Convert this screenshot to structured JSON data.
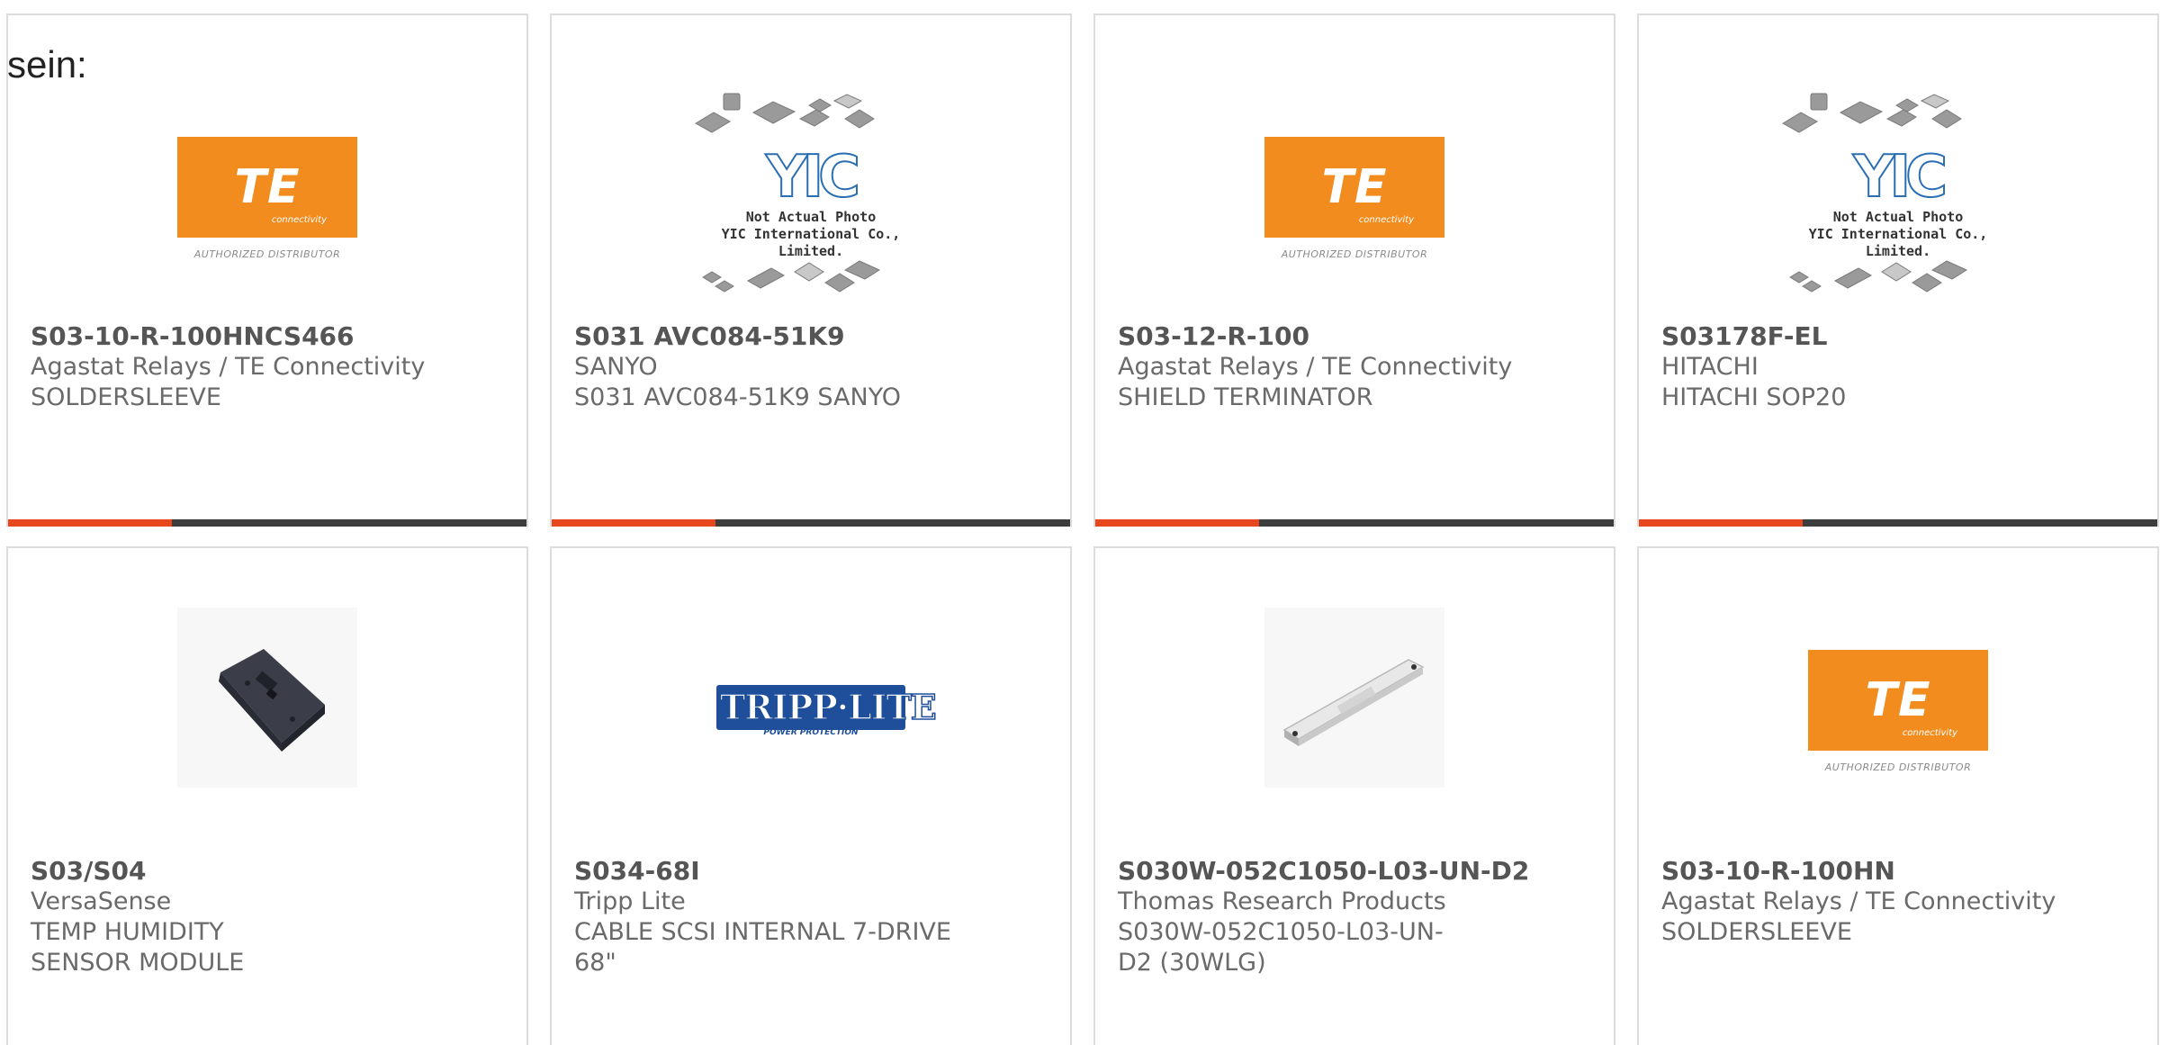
{
  "intro_text": "sein:",
  "colors": {
    "accent": "#e8461c",
    "bar": "#3d3d3d",
    "te_orange": "#f28c1e",
    "tripp_blue": "#1f4e9a"
  },
  "products": [
    {
      "part_number": "S03-10-R-100HNCS466",
      "manufacturer": "Agastat Relays / TE Connectivity",
      "description": "SOLDERSLEEVE",
      "image": "te-logo"
    },
    {
      "part_number": "S031 AVC084-51K9",
      "manufacturer": "SANYO",
      "description": "S031 AVC084-51K9 SANYO",
      "image": "yic-placeholder"
    },
    {
      "part_number": "S03-12-R-100",
      "manufacturer": "Agastat Relays / TE Connectivity",
      "description": "SHIELD TERMINATOR",
      "image": "te-logo"
    },
    {
      "part_number": "S03178F-EL",
      "manufacturer": "HITACHI",
      "description": "HITACHI SOP20",
      "image": "yic-placeholder"
    },
    {
      "part_number": "S03/S04",
      "manufacturer": "VersaSense",
      "description": "TEMP HUMIDITY SENSOR MODULE",
      "image": "sensor-photo"
    },
    {
      "part_number": "S034-68I",
      "manufacturer": "Tripp Lite",
      "description": "CABLE SCSI INTERNAL 7-DRIVE 68\"",
      "image": "tripp-lite-logo"
    },
    {
      "part_number": "S030W-052C1050-L03-UN-D2",
      "manufacturer": "Thomas Research Products",
      "description": "S030W-052C1050-L03-UN-D2 (30WLG)",
      "image": "led-driver-photo"
    },
    {
      "part_number": "S03-10-R-100HN",
      "manufacturer": "Agastat Relays / TE Connectivity",
      "description": "SOLDERSLEEVE",
      "image": "te-logo"
    }
  ],
  "logos": {
    "te_mark": "TE",
    "te_sub": "connectivity",
    "te_foot": "AUTHORIZED DISTRIBUTOR",
    "yic_letters": "YIC",
    "yic_caption_1": "Not Actual Photo",
    "yic_caption_2": "YIC International Co., Limited.",
    "tripp_name": "TRIPP·LITE",
    "tripp_sub": "POWER PROTECTION"
  }
}
